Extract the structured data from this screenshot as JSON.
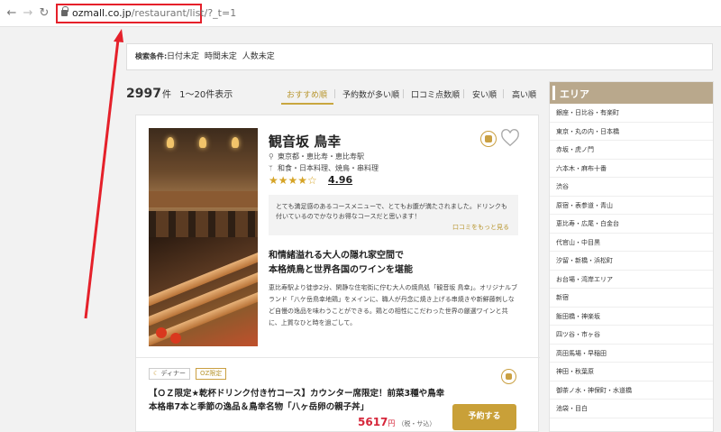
{
  "browser": {
    "url_host": "ozmall.co.jp",
    "url_path": "/restaurant/list/?_t=1",
    "back_icon": "arrow-left-icon",
    "forward_icon": "arrow-right-icon",
    "reload_icon": "reload-icon",
    "lock_icon": "lock-icon"
  },
  "search_conditions": {
    "label": "検索条件:",
    "value": "日付未定 時間未定 人数未定"
  },
  "results": {
    "count": "2997",
    "count_suffix": "件",
    "range": "1〜20件表示"
  },
  "sort": {
    "tabs": [
      "おすすめ順",
      "予約数が多い順",
      "口コミ点数順",
      "安い順",
      "高い順"
    ],
    "active": "おすすめ順"
  },
  "restaurant": {
    "name": "観音坂 鳥幸",
    "location": "東京都・恵比寿・恵比寿駅",
    "genre": "和食・日本料理、焼鳥・串料理",
    "stars": "★★★★☆",
    "rating": "4.96",
    "review": "とても満足感のあるコースメニューで、とてもお腹が満たされました。ドリンクも付いているのでかなりお得なコースだと思います！",
    "review_more": "口コミをもっと見る",
    "catch_line1": "和情緒溢れる大人の隠れ家空間で",
    "catch_line2": "本格焼鳥と世界各国のワインを堪能",
    "description": "恵比寿駅より徒歩2分、閑静な住宅街に佇む大人の焼鳥処「観音坂 鳥幸」。オリジナルブランド「八ケ岳鳥幸地鶏」をメインに、職人が丹念に焼き上げる串焼きや新鮮藤刺しなど自慢の逸品を味わうことができる。鶏との相性にこだわった世界の厳選ワインと共に、上質なひと時を過ごして。"
  },
  "plan": {
    "tag_dinner": "ディナー",
    "tag_dinner_icon": "moon-icon",
    "tag_oz": "OZ限定",
    "title": "【ＯＺ限定★乾杯ドリンク付き竹コース】カウンター席限定！前菜3種や鳥幸本格串7本と季節の逸品＆鳥幸名物「八ヶ岳卵の親子丼」",
    "price": "5617",
    "price_unit": "円",
    "price_tax": "（税・サ込）",
    "reserve_label": "予約する"
  },
  "sidebar": {
    "title": "エリア",
    "areas": [
      "銀座・日比谷・有楽町",
      "東京・丸の内・日本橋",
      "赤坂・虎ノ門",
      "六本木・麻布十番",
      "渋谷",
      "原宿・表参道・青山",
      "恵比寿・広尾・白金台",
      "代官山・中目黒",
      "汐留・新橋・浜松町",
      "お台場・湾岸エリア",
      "新宿",
      "飯田橋・神楽坂",
      "四ツ谷・市ヶ谷",
      "高田馬場・早稲田",
      "神田・秋葉原",
      "御茶ノ水・神保町・水道橋",
      "池袋・目白"
    ]
  },
  "colors": {
    "accent_gold": "#c9a038",
    "highlight_red": "#e5202a",
    "sidebar_header": "#b9a88c",
    "price_red": "#d6263a"
  }
}
